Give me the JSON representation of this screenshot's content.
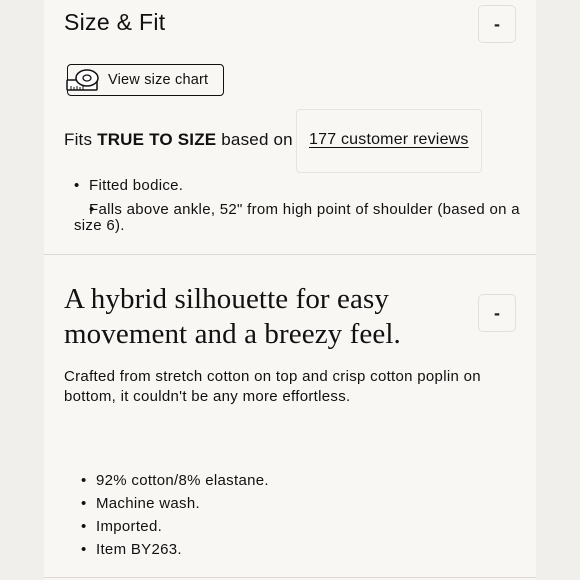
{
  "size_fit": {
    "title": "Size & Fit",
    "toggle_symbol": "-",
    "size_chart_button": {
      "label": "View size chart",
      "icon": "measuring-tape-icon"
    },
    "fits_prefix": "Fits",
    "fits_emphasis": "TRUE TO SIZE",
    "fits_suffix": "based on",
    "reviews_link": "177 customer reviews",
    "bullets": [
      "Fitted bodice.",
      "Falls above ankle, 52\" from high point of shoulder (based on a size 6)."
    ]
  },
  "details": {
    "headline": "A hybrid silhouette for easy movement and a breezy feel.",
    "toggle_symbol": "-",
    "description": "Crafted from stretch cotton on top and crisp cotton poplin on bottom, it couldn't be any more effortless.",
    "bullets": [
      "92% cotton/8% elastane.",
      "Machine wash.",
      "Imported.",
      "Item BY263."
    ]
  },
  "colors": {
    "page_background": "#f1efeb",
    "panel_background": "#f8f7f4",
    "text": "#111111",
    "divider": "#dcd9d4"
  }
}
